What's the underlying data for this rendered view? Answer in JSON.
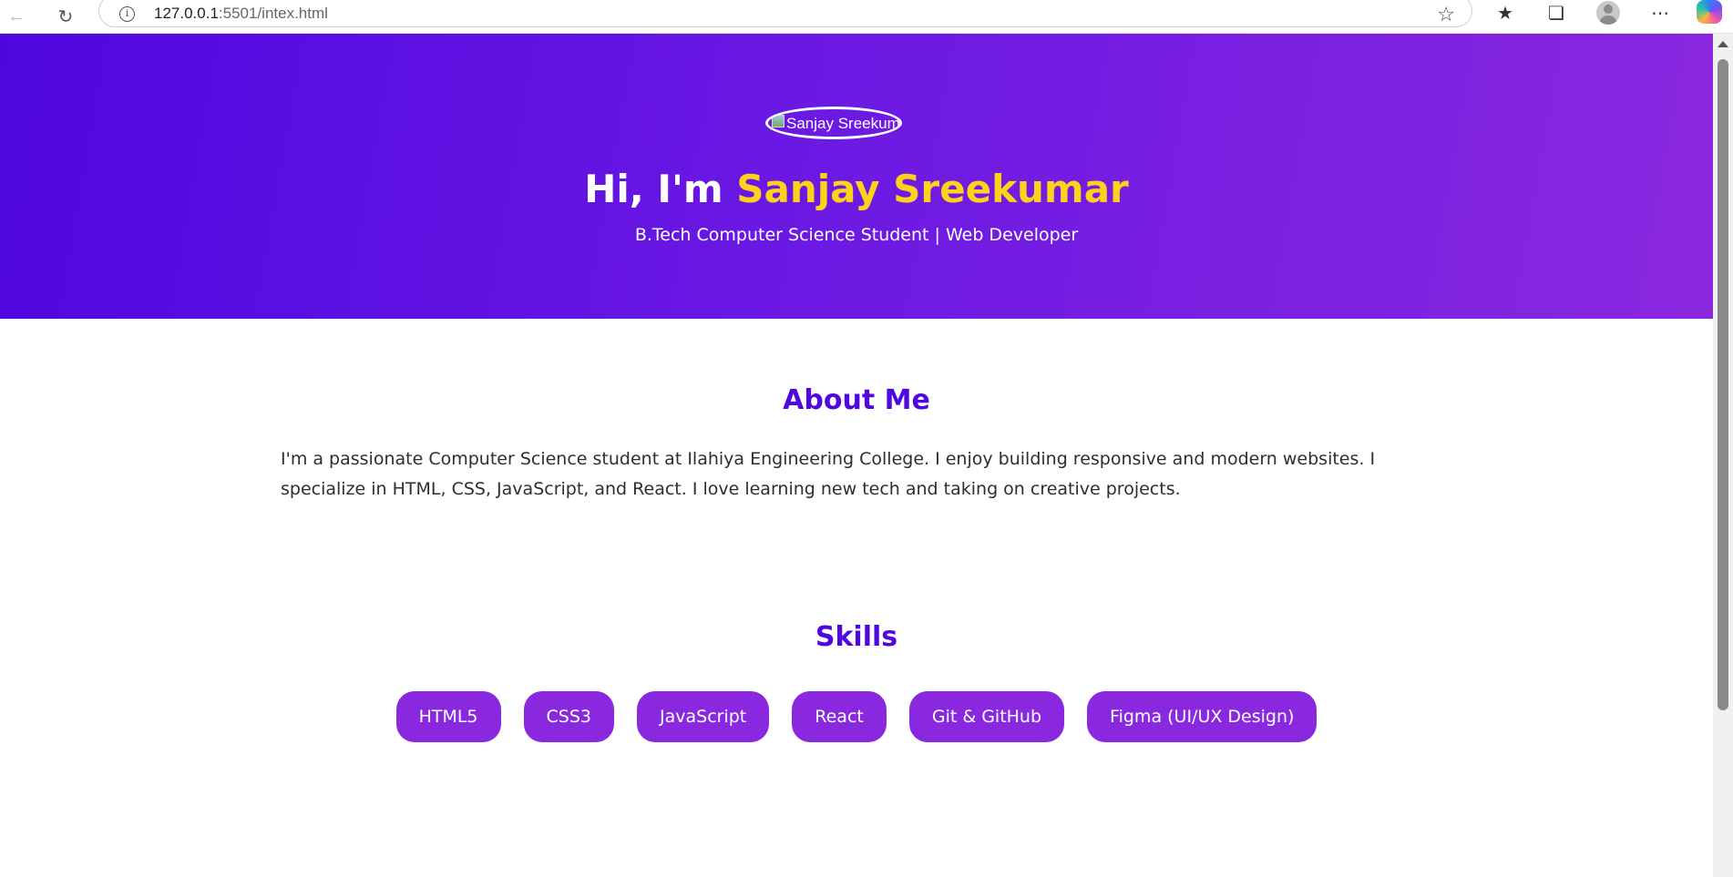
{
  "browser": {
    "url_host": "127.0.0.1",
    "url_rest": ":5501/intex.html"
  },
  "hero": {
    "profile_image_alt": "Sanjay Sreekumar",
    "greeting": "Hi, I'm ",
    "name": "Sanjay Sreekumar",
    "subtitle": "B.Tech Computer Science Student | Web Developer"
  },
  "about": {
    "title": "About Me",
    "text": "I'm a passionate Computer Science student at Ilahiya Engineering College. I enjoy building responsive and modern websites. I specialize in HTML, CSS, JavaScript, and React. I love learning new tech and taking on creative projects."
  },
  "skills": {
    "title": "Skills",
    "items": [
      "HTML5",
      "CSS3",
      "JavaScript",
      "React",
      "Git & GitHub",
      "Figma (UI/UX Design)"
    ]
  },
  "colors": {
    "hero_start": "#4f07e0",
    "hero_end": "#8a28df",
    "name_highlight": "#ffd21a",
    "section_title": "#4f07e0",
    "skill_pill": "#8a28df"
  }
}
